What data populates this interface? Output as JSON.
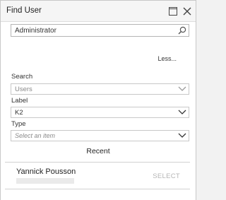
{
  "dialog": {
    "title": "Find User",
    "maximize_icon": "maximize-icon",
    "close_icon": "close-icon"
  },
  "search": {
    "value": "Administrator",
    "icon": "search-icon"
  },
  "toggle": {
    "less_label": "Less..."
  },
  "filters": {
    "search_label": "Search",
    "search_value": "Users",
    "label_label": "Label",
    "label_value": "K2",
    "type_label": "Type",
    "type_placeholder": "Select an item",
    "chevron_icon": "chevron-down-icon"
  },
  "recent": {
    "heading": "Recent",
    "items": [
      {
        "name": "Yannick Pousson",
        "action": "SELECT"
      }
    ]
  }
}
